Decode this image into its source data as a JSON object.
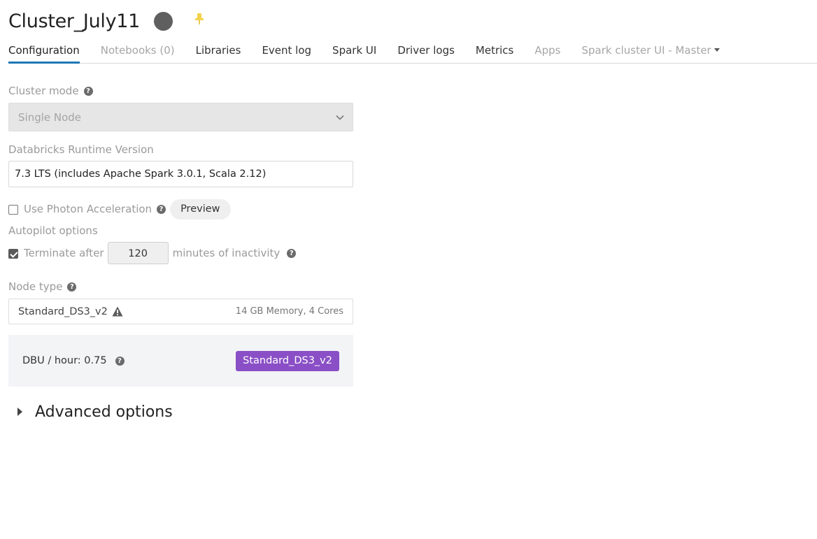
{
  "header": {
    "title": "Cluster_July11",
    "status_color": "#5f5f5f",
    "pin_color": "#f2d24a"
  },
  "tabs": [
    {
      "label": "Configuration",
      "active": true
    },
    {
      "label": "Notebooks (0)",
      "disabled": true
    },
    {
      "label": "Libraries"
    },
    {
      "label": "Event log"
    },
    {
      "label": "Spark UI"
    },
    {
      "label": "Driver logs"
    },
    {
      "label": "Metrics"
    },
    {
      "label": "Apps",
      "disabled": true
    },
    {
      "label": "Spark cluster UI - Master",
      "disabled": true,
      "dropdown": true
    }
  ],
  "cluster_mode": {
    "label": "Cluster mode",
    "value": "Single Node"
  },
  "runtime": {
    "label": "Databricks Runtime Version",
    "value": "7.3 LTS (includes Apache Spark 3.0.1, Scala 2.12)"
  },
  "photon": {
    "label": "Use Photon Acceleration",
    "checked": false,
    "preview_label": "Preview"
  },
  "autopilot": {
    "label": "Autopilot options",
    "terminate_label": "Terminate after",
    "checked": true,
    "minutes": "120",
    "suffix": "minutes of inactivity"
  },
  "node_type": {
    "label": "Node type",
    "value": "Standard_DS3_v2",
    "spec": "14 GB Memory, 4 Cores"
  },
  "dbu": {
    "text": "DBU / hour: 0.75",
    "badge": "Standard_DS3_v2",
    "badge_color": "#8a4fc6"
  },
  "advanced": {
    "label": "Advanced options"
  }
}
